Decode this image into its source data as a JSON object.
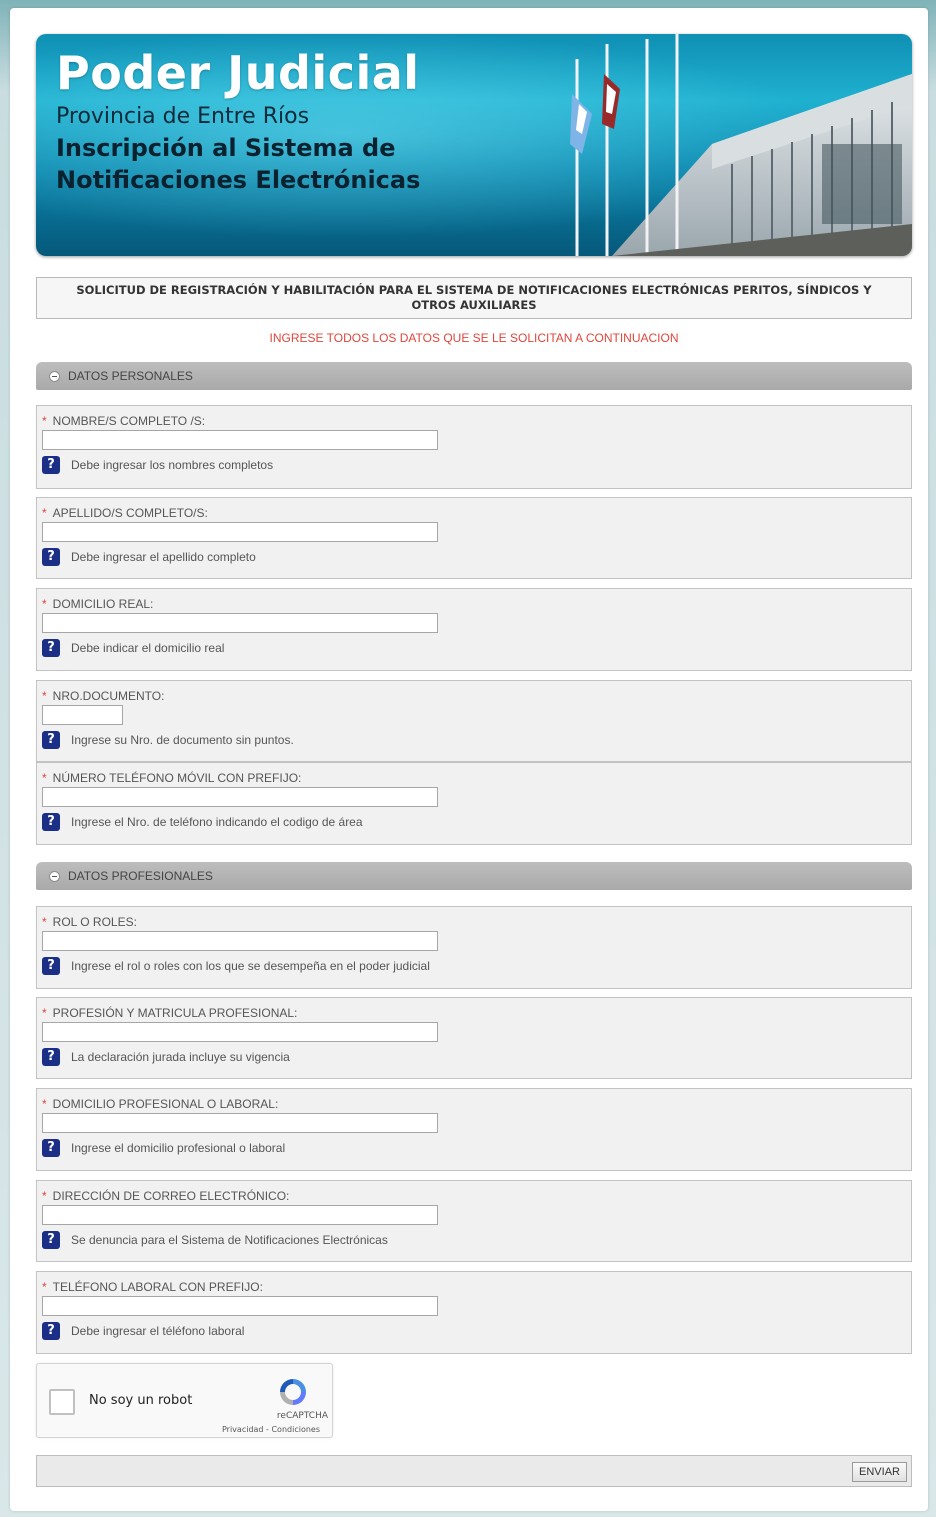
{
  "banner": {
    "title": "Poder Judicial",
    "subtitle": "Provincia de Entre Ríos",
    "heading": "Inscripción al Sistema de Notificaciones Electrónicas"
  },
  "form": {
    "header": "SOLICITUD DE REGISTRACIÓN Y HABILITACIÓN PARA EL SISTEMA DE NOTIFICACIONES ELECTRÓNICAS PERITOS, SÍNDICOS Y OTROS AUXILIARES",
    "instruction": "INGRESE TODOS LOS DATOS QUE SE LE SOLICITAN A CONTINUACION",
    "required_mark": "*",
    "help_icon": "?",
    "sections": {
      "personal": "DATOS PERSONALES",
      "professional": "DATOS PROFESIONALES"
    },
    "fields": [
      {
        "label": "NOMBRE/S COMPLETO /S:",
        "value": "",
        "help": "Debe ingresar los nombres completos"
      },
      {
        "label": "APELLIDO/S COMPLETO/S:",
        "value": "",
        "help": "Debe ingresar el apellido completo"
      },
      {
        "label": "DOMICILIO REAL:",
        "value": "",
        "help": "Debe indicar el domicilio real"
      },
      {
        "label": "NRO.DOCUMENTO:",
        "value": "",
        "help": "Ingrese su Nro. de documento sin puntos."
      },
      {
        "label": "NÚMERO TELÉFONO MÓVIL CON PREFIJO:",
        "value": "",
        "help": "Ingrese el Nro. de teléfono indicando el codigo de área"
      },
      {
        "label": "ROL O ROLES:",
        "value": "",
        "help": "Ingrese el rol o roles con los que se desempeña en el poder judicial"
      },
      {
        "label": "PROFESIÓN Y MATRICULA PROFESIONAL:",
        "value": "",
        "help": "La declaración jurada incluye su vigencia"
      },
      {
        "label": "DOMICILIO PROFESIONAL O LABORAL:",
        "value": "",
        "help": "Ingrese el domicilio profesional o laboral"
      },
      {
        "label": "DIRECCIÓN DE CORREO ELECTRÓNICO:",
        "value": "",
        "help": "Se denuncia para el Sistema de Notificaciones Electrónicas"
      },
      {
        "label": "TELÉFONO LABORAL CON PREFIJO:",
        "value": "",
        "help": "Debe ingresar el téléfono laboral"
      }
    ],
    "submit_label": "ENVIAR"
  },
  "captcha": {
    "label": "No soy un robot",
    "brand": "reCAPTCHA",
    "links": "Privacidad - Condiciones",
    "checked": false
  }
}
